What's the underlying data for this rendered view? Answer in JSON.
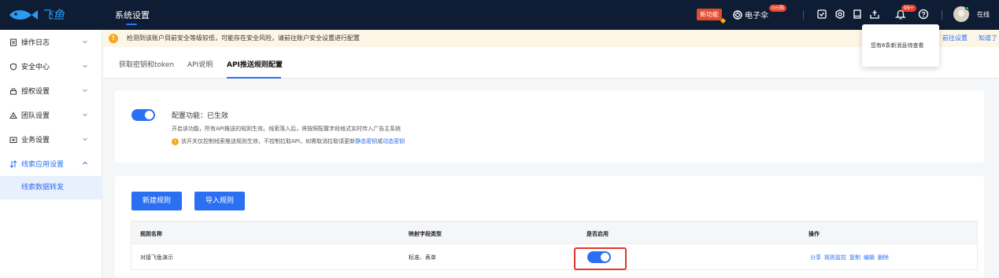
{
  "header": {
    "logo_text": "飞鱼",
    "title": "系统设置",
    "new_feature": "新功能",
    "brand": "电子伞",
    "brand_badge": "0元购",
    "bell_badge": "99+",
    "status": "在线"
  },
  "sidebar": {
    "items": [
      {
        "label": "操作日志",
        "icon": "log-icon"
      },
      {
        "label": "安全中心",
        "icon": "shield-icon"
      },
      {
        "label": "授权设置",
        "icon": "lock-icon"
      },
      {
        "label": "团队设置",
        "icon": "team-icon"
      },
      {
        "label": "业务设置",
        "icon": "business-icon"
      },
      {
        "label": "线索应用设置",
        "icon": "lead-app-icon"
      }
    ],
    "sub_item": "线索数据转发"
  },
  "banner": {
    "text": "检测到该账户目前安全等级较低，可能存在安全风险，请前往账户安全设置进行配置",
    "link_go": "前往设置",
    "link_ok": "知道了"
  },
  "tabs": [
    {
      "label": "获取密钥和token"
    },
    {
      "label": "API说明"
    },
    {
      "label": "API推送规则配置"
    }
  ],
  "config": {
    "label": "配置功能：已生效",
    "description": "开启该功能，所有API推送的规则生效。线索落入后，将按照配置字段格式实时传入广告主系统",
    "note_prefix": "该开关仅控制线索推送规则生效，不控制拉取API，如需取消拉取请更新",
    "note_link1": "静态密钥",
    "note_mid": "或",
    "note_link2": "动态密钥"
  },
  "actions": {
    "new_rule": "新建规则",
    "import_rule": "导入规则"
  },
  "table": {
    "headers": [
      "规则名称",
      "映射字段类型",
      "是否启用",
      "操作"
    ],
    "rows": [
      {
        "name": "对接飞鱼演示",
        "field_type": "标准、表单",
        "enabled": true,
        "operations": [
          "分享",
          "规则监控",
          "复制",
          "编辑",
          "删除"
        ]
      }
    ]
  },
  "popup": {
    "text": "您有6条新消息待查看"
  }
}
